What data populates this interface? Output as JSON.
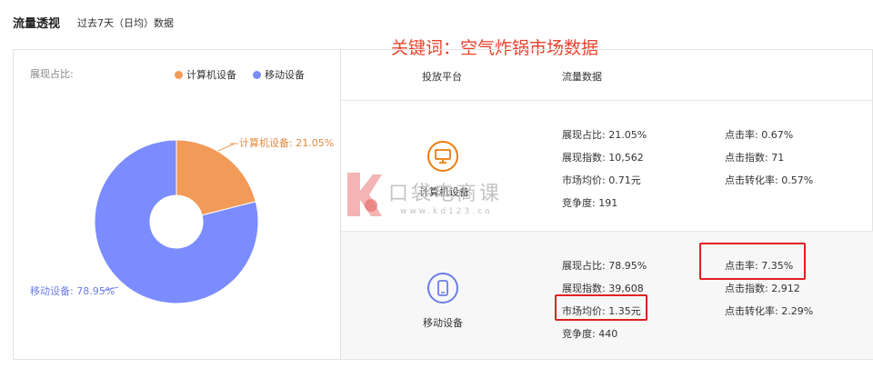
{
  "header": {
    "title": "流量透视",
    "subtitle": "过去7天（日均）数据"
  },
  "keyword_overlay": "关键词：空气炸锅市场数据",
  "left_panel": {
    "share_label": "展现占比:",
    "legend": [
      {
        "name": "计算机设备",
        "color": "#f29b58"
      },
      {
        "name": "移动设备",
        "color": "#7b8cff"
      }
    ]
  },
  "chart_data": {
    "type": "pie",
    "categories": [
      "计算机设备",
      "移动设备"
    ],
    "values": [
      21.05,
      78.95
    ],
    "unit": "%",
    "colors": [
      "#f29b58",
      "#7b8cff"
    ],
    "labels": [
      "计算机设备: 21.05%",
      "移动设备: 78.95%"
    ],
    "donut": true
  },
  "table": {
    "columns": [
      "投放平台",
      "流量数据"
    ],
    "rows": [
      {
        "platform": "计算机设备",
        "icon": "monitor-icon",
        "icon_color": "#f07b0c",
        "left_metrics": [
          "展现占比: 21.05%",
          "展现指数: 10,562",
          "市场均价: 0.71元",
          "竞争度: 191"
        ],
        "right_metrics": [
          "点击率: 0.67%",
          "点击指数: 71",
          "点击转化率: 0.57%"
        ]
      },
      {
        "platform": "移动设备",
        "icon": "mobile-phone-icon",
        "icon_color": "#6a7de8",
        "left_metrics": [
          "展现占比: 78.95%",
          "展现指数: 39,608",
          "市场均价: 1.35元",
          "竞争度: 440"
        ],
        "right_metrics": [
          "点击率: 7.35%",
          "点击指数: 2,912",
          "点击转化率: 2.29%"
        ]
      }
    ]
  },
  "watermark": {
    "brand": "口袋电商课",
    "url": "www.kd123.cn"
  }
}
